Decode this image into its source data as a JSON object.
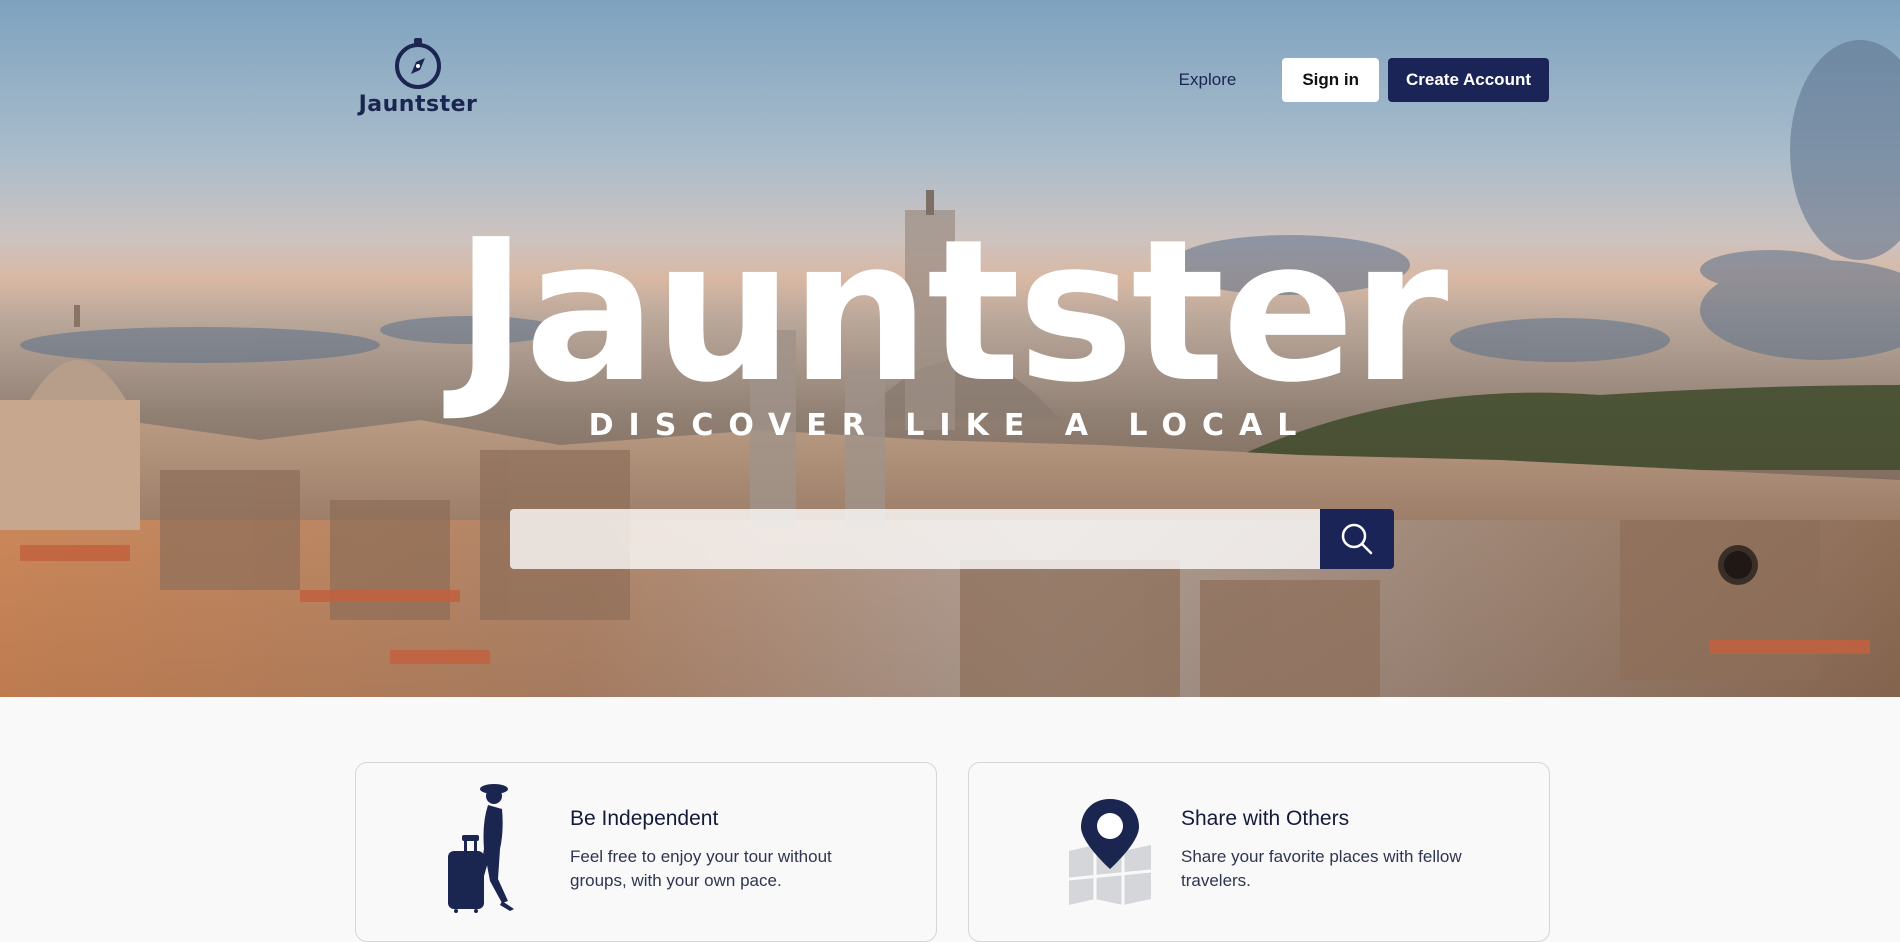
{
  "header": {
    "logo_text": "Jauntster",
    "nav": {
      "explore_label": "Explore",
      "signin_label": "Sign in",
      "create_label": "Create Account"
    }
  },
  "hero": {
    "title": "Jauntster",
    "subtitle": "DISCOVER LIKE A LOCAL",
    "search": {
      "placeholder": "",
      "value": ""
    },
    "icons": {
      "search": "search-icon",
      "logo": "compass-icon"
    }
  },
  "features": [
    {
      "title": "Be Independent",
      "description": "Feel free to enjoy your tour without groups, with your own pace.",
      "icon": "traveler-with-suitcase-icon"
    },
    {
      "title": "Share with Others",
      "description": "Share your favorite places with fellow travelers.",
      "icon": "map-pin-icon"
    }
  ],
  "colors": {
    "brand_navy": "#1b2457",
    "text_navy": "#1a2550",
    "page_bg": "#f9f9f9"
  }
}
